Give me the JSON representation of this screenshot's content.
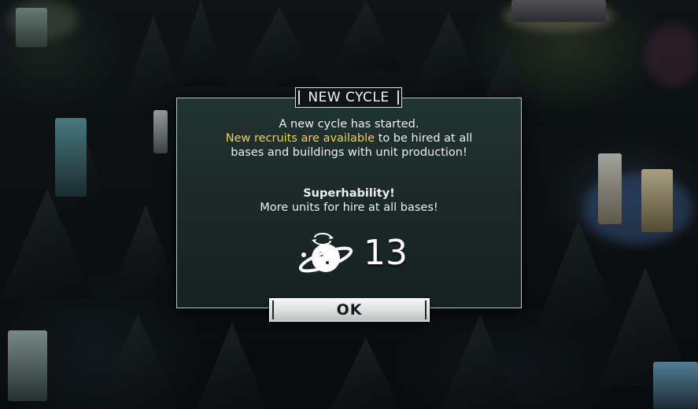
{
  "dialog": {
    "title": "NEW CYCLE",
    "line1": "A new cycle has started.",
    "line2_highlight": "New recruits are available",
    "line2_rest": " to be hired at all",
    "line3": "bases and buildings with unit production!",
    "bonus_title": "Superhability!",
    "bonus_text": "More units for hire at all bases!",
    "reward_icon": "planet-orbit-icon",
    "reward_value": "13",
    "ok_label": "OK"
  },
  "colors": {
    "highlight": "#f3cf5a",
    "panel": "#1b2a28",
    "text": "#eef0ef"
  }
}
